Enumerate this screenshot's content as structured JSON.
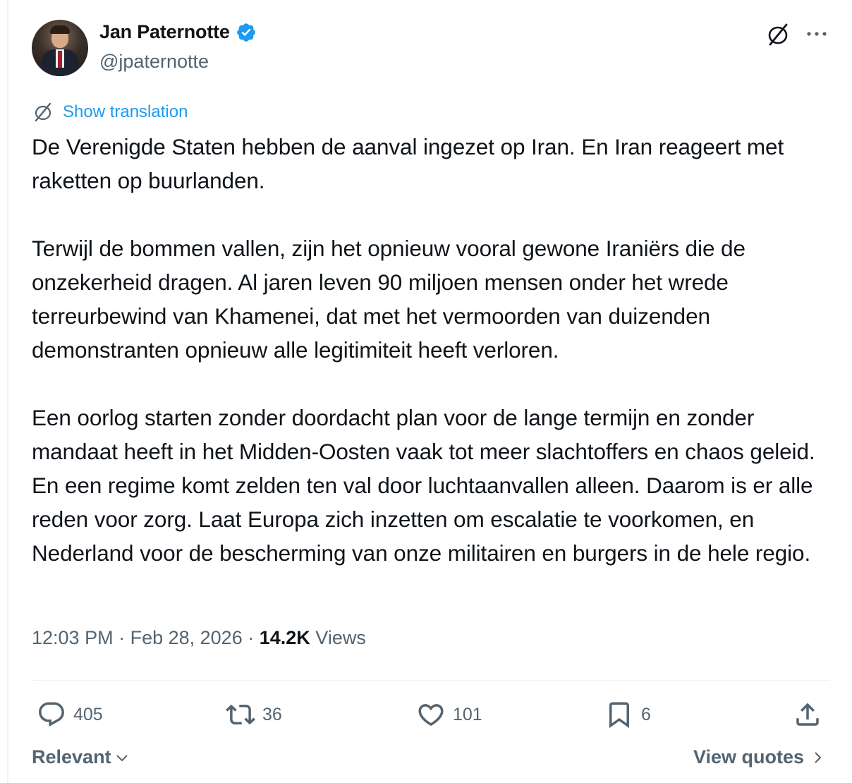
{
  "author": {
    "display_name": "Jan Paternotte",
    "handle": "@jpaternotte",
    "verified": true
  },
  "translate_label": "Show translation",
  "tweet": {
    "paragraphs": [
      "De Verenigde Staten hebben de aanval ingezet op Iran. En Iran reageert met raketten op buurlanden.",
      "Terwijl de bommen vallen, zijn het opnieuw vooral gewone Iraniërs die de onzekerheid dragen. Al jaren leven 90 miljoen mensen onder het wrede terreurbewind van Khamenei, dat met het vermoorden van duizenden demonstranten opnieuw alle legitimiteit heeft verloren.",
      "Een oorlog starten zonder doordacht plan voor de lange termijn en zonder mandaat heeft in het Midden-Oosten vaak tot meer slachtoffers en chaos geleid. En een regime komt zelden ten val door luchtaanvallen alleen. Daarom is er alle reden voor zorg. Laat Europa zich inzetten om escalatie te voorkomen, en Nederland voor de bescherming van onze militairen en burgers in de hele regio."
    ]
  },
  "meta": {
    "time": "12:03 PM",
    "date": "Feb 28, 2026",
    "separator": " · ",
    "views_count": "14.2K",
    "views_label": "Views"
  },
  "actions": {
    "replies": "405",
    "reposts": "36",
    "likes": "101",
    "bookmarks": "6"
  },
  "footer": {
    "sort_label": "Relevant",
    "quotes_label": "View quotes"
  },
  "icons": [
    "verified-badge-icon",
    "grok-icon",
    "more-icon",
    "translate-icon",
    "reply-icon",
    "repost-icon",
    "like-icon",
    "bookmark-icon",
    "share-icon",
    "chevron-down-icon",
    "chevron-right-icon"
  ],
  "colors": {
    "accent": "#1d9bf0",
    "text": "#0f1419",
    "muted": "#536471",
    "divider": "#eff3f4"
  }
}
